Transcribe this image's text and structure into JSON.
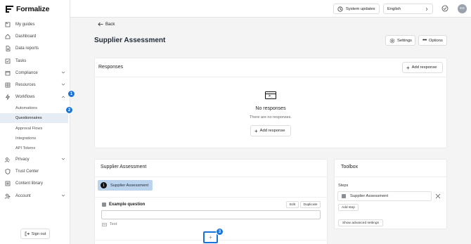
{
  "app": {
    "name": "Formalize"
  },
  "sidebar": {
    "items": [
      {
        "label": "My guides",
        "icon": "guide-icon"
      },
      {
        "label": "Dashboard",
        "icon": "home-icon"
      },
      {
        "label": "Data reports",
        "icon": "file-icon"
      },
      {
        "label": "Tasks",
        "icon": "tasks-icon"
      },
      {
        "label": "Compliance",
        "icon": "compliance-icon",
        "expandable": true
      },
      {
        "label": "Resources",
        "icon": "resources-icon",
        "expandable": true
      },
      {
        "label": "Workflows",
        "icon": "workflow-icon",
        "expanded": true
      }
    ],
    "workflow_sub": [
      "Automations",
      "Questionnaires",
      "Approval Flows",
      "Integrations",
      "API Tokens"
    ],
    "items_after": [
      {
        "label": "Privacy",
        "icon": "privacy-icon",
        "expandable": true
      },
      {
        "label": "Trust Center",
        "icon": "shield-icon"
      },
      {
        "label": "Content library",
        "icon": "library-icon"
      },
      {
        "label": "Account",
        "icon": "account-icon",
        "expandable": true
      }
    ],
    "signout": "Sign out"
  },
  "badges": [
    "1",
    "2",
    "3"
  ],
  "topbar": {
    "system_updates": "System updates",
    "language": "English",
    "avatar": "ES"
  },
  "page": {
    "back": "Back",
    "title": "Supplier Assessment",
    "settings": "Settings",
    "options": "Options"
  },
  "responses": {
    "title": "Responses",
    "add_response": "Add response",
    "empty_title": "No responses",
    "empty_text": "There are no responses.",
    "empty_button": "Add response"
  },
  "builder": {
    "title": "Supplier Assessment",
    "step_number": "1",
    "step_label": "Supplier Assessment",
    "question": "Example question",
    "edit": "Edit",
    "duplicate": "Duplicate",
    "answer_type": "Text",
    "add": "+"
  },
  "toolbox": {
    "title": "Toolbox",
    "steps_label": "Steps",
    "step": "Supplier Assessment",
    "add_step": "Add step",
    "advanced": "Show advanced settings"
  },
  "colors": {
    "accent": "#1a73d9",
    "active_bg": "#e7edf5",
    "step_pill": "#bcd3ee"
  }
}
